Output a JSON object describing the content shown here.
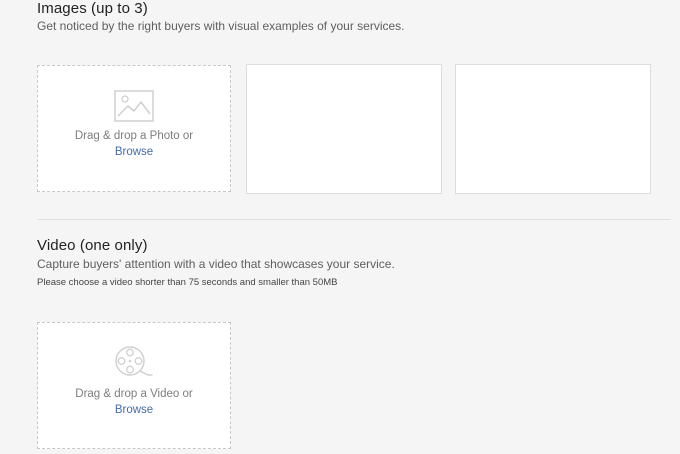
{
  "images": {
    "title": "Images (up to 3)",
    "description": "Get noticed by the right buyers with visual examples of your services.",
    "drop_text": "Drag & drop a Photo or",
    "browse_label": "Browse"
  },
  "video": {
    "title": "Video (one only)",
    "description": "Capture buyers' attention with a video that showcases your service.",
    "note": "Please choose a video shorter than 75 seconds and smaller than 50MB",
    "drop_text": "Drag & drop a Video or",
    "browse_label": "Browse"
  },
  "icons": {
    "photo": "image-icon",
    "video": "film-reel-icon"
  },
  "colors": {
    "background": "#f5f5f5",
    "link": "#446ea8",
    "icon": "#d0d0d0"
  }
}
